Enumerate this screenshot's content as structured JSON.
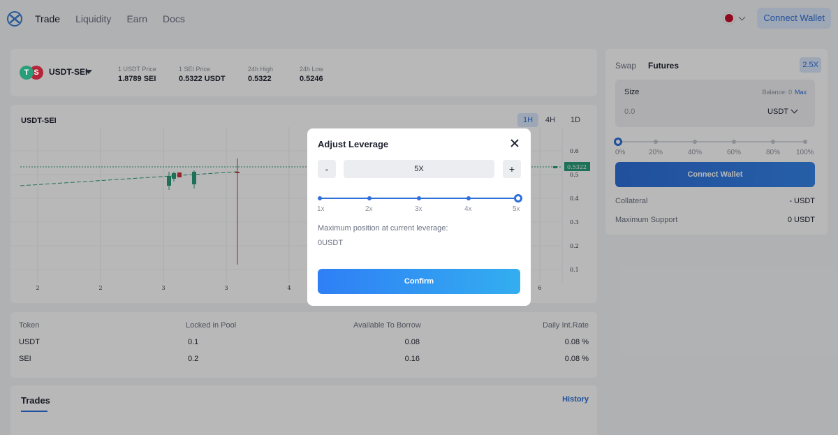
{
  "nav": {
    "links": [
      "Trade",
      "Liquidity",
      "Earn",
      "Docs"
    ],
    "connect_label": "Connect Wallet"
  },
  "pair": {
    "name": "USDT-SEI",
    "stats": [
      {
        "label": "1 USDT Price",
        "value": "1.8789 SEI"
      },
      {
        "label": "1 SEI Price",
        "value": "0.5322 USDT"
      },
      {
        "label": "24h High",
        "value": "0.5322"
      },
      {
        "label": "24h Low",
        "value": "0.5246"
      }
    ]
  },
  "chart": {
    "title": "USDT-SEI",
    "timeframes": [
      "1H",
      "4H",
      "1D"
    ],
    "active_timeframe": "1H",
    "price_tag": "0.5322",
    "y_ticks": [
      "0.6",
      "0.5",
      "0.4",
      "0.3",
      "0.2",
      "0.1"
    ],
    "x_ticks": [
      "2",
      "2",
      "3",
      "3",
      "4",
      "6"
    ]
  },
  "pool": {
    "headers": [
      "Token",
      "Locked in Pool",
      "Available To Borrow",
      "Daily Int.Rate"
    ],
    "rows": [
      [
        "USDT",
        "0.1",
        "0.08",
        "0.08 %"
      ],
      [
        "SEI",
        "0.2",
        "0.16",
        "0.08 %"
      ]
    ]
  },
  "trades": {
    "tab": "Trades",
    "history": "History"
  },
  "side": {
    "tabs": [
      "Swap",
      "Futures"
    ],
    "leverage_badge": "2.5X",
    "size_label": "Size",
    "balance_label": "Balance: 0",
    "max_label": "Max",
    "size_placeholder": "0.0",
    "size_unit": "USDT",
    "pct_labels": [
      "0%",
      "20%",
      "40%",
      "60%",
      "80%",
      "100%"
    ],
    "pct_value": 0,
    "connect_label": "Connect Wallet",
    "collateral_label": "Collateral",
    "collateral_value": "- USDT",
    "max_support_label": "Maximum Support",
    "max_support_value": "0 USDT"
  },
  "modal": {
    "title": "Adjust Leverage",
    "minus": "-",
    "plus": "+",
    "leverage_value": "5X",
    "marks": [
      "1x",
      "2x",
      "3x",
      "4x",
      "5x"
    ],
    "max_position_label": "Maximum position at current leverage:",
    "max_position_value": "0USDT",
    "confirm_label": "Confirm"
  }
}
